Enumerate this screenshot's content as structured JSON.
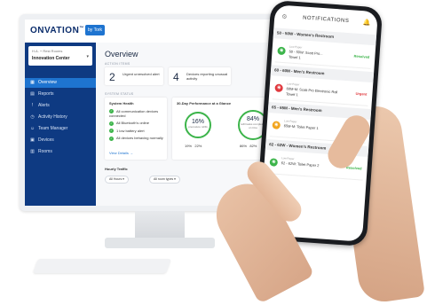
{
  "brand": {
    "name": "ONVATION",
    "tm": "™",
    "badge": "by Tork"
  },
  "sidebar": {
    "location_sub": "H.A. + Rest Rooms",
    "location_name": "Innovation Center",
    "items": [
      {
        "label": "Overview",
        "icon": "grid-icon",
        "active": true
      },
      {
        "label": "Reports",
        "icon": "chart-icon"
      },
      {
        "label": "Alerts",
        "icon": "alert-icon"
      },
      {
        "label": "Activity History",
        "icon": "history-icon"
      },
      {
        "label": "Team Manager",
        "icon": "team-icon"
      },
      {
        "label": "Devices",
        "icon": "device-icon"
      },
      {
        "label": "Rooms",
        "icon": "room-icon"
      }
    ]
  },
  "main": {
    "title": "Overview",
    "action_items_label": "ACTION ITEMS",
    "action_items": [
      {
        "count": "2",
        "text": "Urgent unresolved alert"
      },
      {
        "count": "4",
        "text": "Devices reporting unusual activity"
      }
    ],
    "system_status_label": "SYSTEM STATUS",
    "system_health": {
      "title": "System Health",
      "items": [
        "All communication devices connected",
        "All Bluetooth's online",
        "1 low battery alert",
        "All devices behaving normally"
      ],
      "link": "View Details →"
    },
    "performance": {
      "title": "30-Day Performance at a Glance",
      "left_pct": "16%",
      "left_sub": "premature refills",
      "right_pct": "84%",
      "right_sub": "refill tasks completed on time",
      "left_stats": [
        "19%",
        "22%"
      ],
      "right_stats": [
        "86%",
        "82%"
      ]
    },
    "hourly": {
      "title": "Hourly Traffic",
      "filter1": "All Hours",
      "filter2": "All room types"
    }
  },
  "phone": {
    "title": "NOTIFICATIONS",
    "groups": [
      {
        "header": "50 - 50W - Women's Restroom",
        "items": [
          {
            "type": "Low Paper",
            "line1": "50 - 50W: Scott Pro...",
            "line2": "Towel 1",
            "status": "Resolved",
            "status_color": "#3cb44a",
            "dot": "#3cb44a"
          }
        ]
      },
      {
        "header": "60 - 60M - Men's Restroom",
        "items": [
          {
            "type": "Low Paper",
            "line1": "60M-M: Scott Pro Electronic Roll",
            "line2": "Towel 1",
            "status": "Urgent",
            "status_color": "#e0393e",
            "dot": "#e0393e"
          }
        ]
      },
      {
        "header": "65 - 65M - Men's Restroom",
        "items": [
          {
            "type": "Low Paper",
            "line1": "65M-M: Toilet Paper 1",
            "line2": "",
            "status": "",
            "status_color": "#333",
            "dot": "#f2a51f"
          }
        ]
      },
      {
        "header": "62 - 62W - Women's Restroom",
        "items": [
          {
            "type": "Low Paper",
            "line1": "62 - 62W: Toilet Paper 2",
            "line2": "",
            "status": "Resolved",
            "status_color": "#3cb44a",
            "dot": "#3cb44a"
          }
        ]
      }
    ]
  }
}
